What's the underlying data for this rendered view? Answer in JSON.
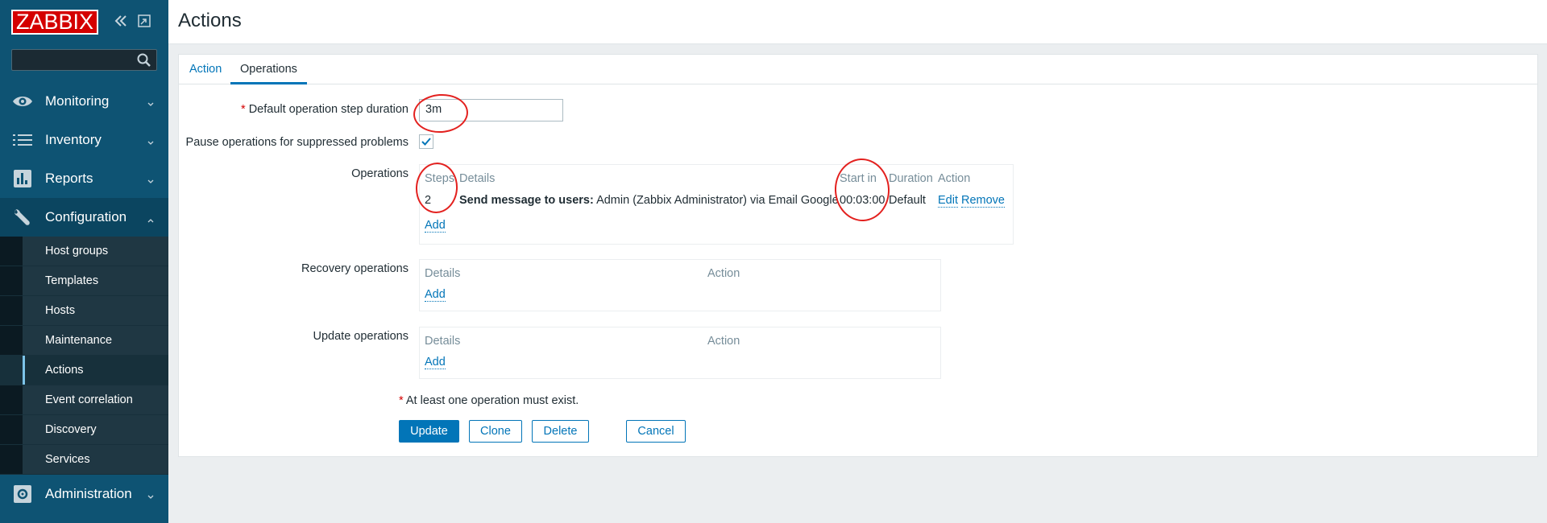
{
  "app": {
    "logo": "ZABBIX",
    "page_title": "Actions"
  },
  "sidebar": {
    "search_placeholder": "",
    "menu": [
      {
        "label": "Monitoring",
        "icon": "eye-icon"
      },
      {
        "label": "Inventory",
        "icon": "list-icon"
      },
      {
        "label": "Reports",
        "icon": "bar-chart-icon"
      },
      {
        "label": "Configuration",
        "icon": "wrench-icon"
      },
      {
        "label": "Administration",
        "icon": "gear-icon"
      }
    ],
    "config_submenu": [
      "Host groups",
      "Templates",
      "Hosts",
      "Maintenance",
      "Actions",
      "Event correlation",
      "Discovery",
      "Services"
    ]
  },
  "tabs": [
    "Action",
    "Operations"
  ],
  "form": {
    "step_duration_label": "Default operation step duration",
    "step_duration_value": "3m",
    "pause_label": "Pause operations for suppressed problems",
    "pause_checked": true,
    "operations_label": "Operations",
    "operations_headers": [
      "Steps",
      "Details",
      "Start in",
      "Duration",
      "Action"
    ],
    "operations_row": {
      "steps": "2",
      "details_bold": "Send message to users:",
      "details_rest": "Admin (Zabbix Administrator) via Email Google",
      "start_in": "00:03:00",
      "duration": "Default",
      "edit": "Edit",
      "remove": "Remove"
    },
    "add_label": "Add",
    "recovery_label": "Recovery operations",
    "update_ops_label": "Update operations",
    "sub_headers": [
      "Details",
      "Action"
    ],
    "note": "At least one operation must exist.",
    "required_mark": "*"
  },
  "buttons": {
    "update": "Update",
    "clone": "Clone",
    "delete": "Delete",
    "cancel": "Cancel"
  }
}
